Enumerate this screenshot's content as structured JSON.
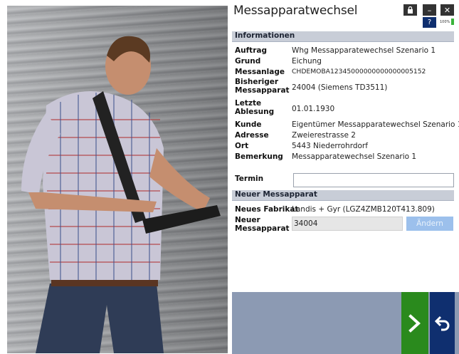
{
  "app": {
    "title": "Messapparatwechsel",
    "lock_icon": "lock-icon",
    "minimize_label": "–",
    "close_label": "✕",
    "help_label": "?",
    "battery_text": "100%"
  },
  "informationen": {
    "header": "Informationen",
    "rows": [
      {
        "label": "Auftrag",
        "value": "Whg Messapparatewechsel Szenario 1"
      },
      {
        "label": "Grund",
        "value": "Eichung"
      },
      {
        "label": "Messanlage",
        "value": "CHDEMOBA12345000000000000005152"
      },
      {
        "label": "Bisheriger Messapparat",
        "value": "24004 (Siemens TD3511)"
      },
      {
        "label": "Letzte Ablesung",
        "value": "01.01.1930"
      },
      {
        "label": "Kunde",
        "value": "Eigentümer Messapparatewechsel Szenario 1"
      },
      {
        "label": "Adresse",
        "value": "Zweierestrasse 2"
      },
      {
        "label": "Ort",
        "value": "5443 Niederrohrdorf"
      },
      {
        "label": "Bemerkung",
        "value": "Messapparatewechsel Szenario 1"
      }
    ],
    "termin_label": "Termin",
    "termin_value": ""
  },
  "neuer_messapparat": {
    "header": "Neuer Messapparat",
    "fabrikat_label": "Neues Fabrikat",
    "fabrikat_value": "Landis + Gyr (LGZ4ZMB120T413.809)",
    "neuer_label": "Neuer Messapparat",
    "neuer_value": "34004",
    "andern_label": "Ändern"
  },
  "actions": {
    "next_icon": "chevron-right-icon",
    "back_icon": "undo-arrow-icon"
  },
  "colors": {
    "section_bg": "#c8cdd7",
    "bottom_bar": "#8c9ab3",
    "next_green": "#2a8a1d",
    "back_navy": "#0f2f6f",
    "andern_disabled": "#9cc0ec"
  }
}
